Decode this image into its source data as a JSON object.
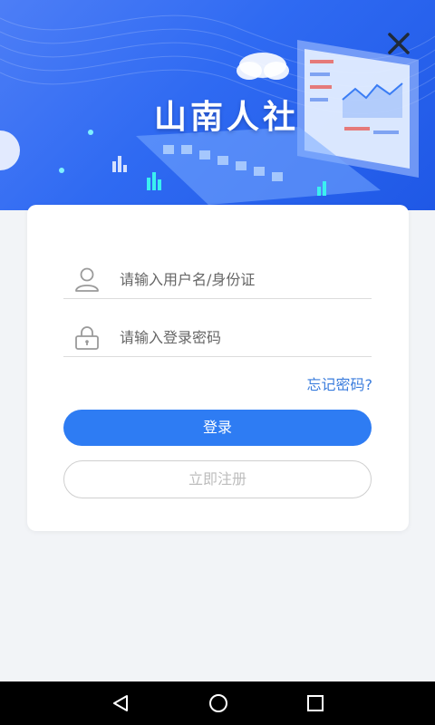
{
  "app": {
    "title": "山南人社"
  },
  "header": {
    "close_icon": "close-icon"
  },
  "login": {
    "username_placeholder": "请输入用户名/身份证",
    "password_placeholder": "请输入登录密码",
    "username_icon": "user-icon",
    "password_icon": "lock-icon",
    "forgot_label": "忘记密码?",
    "login_label": "登录",
    "register_label": "立即注册"
  },
  "navbar": {
    "back_icon": "back-triangle-icon",
    "home_icon": "home-circle-icon",
    "recents_icon": "recents-square-icon"
  },
  "colors": {
    "banner_primary": "#2f6af2",
    "accent": "#2e7cf3",
    "link": "#3b7ddd",
    "page_bg": "#f2f4f7"
  }
}
